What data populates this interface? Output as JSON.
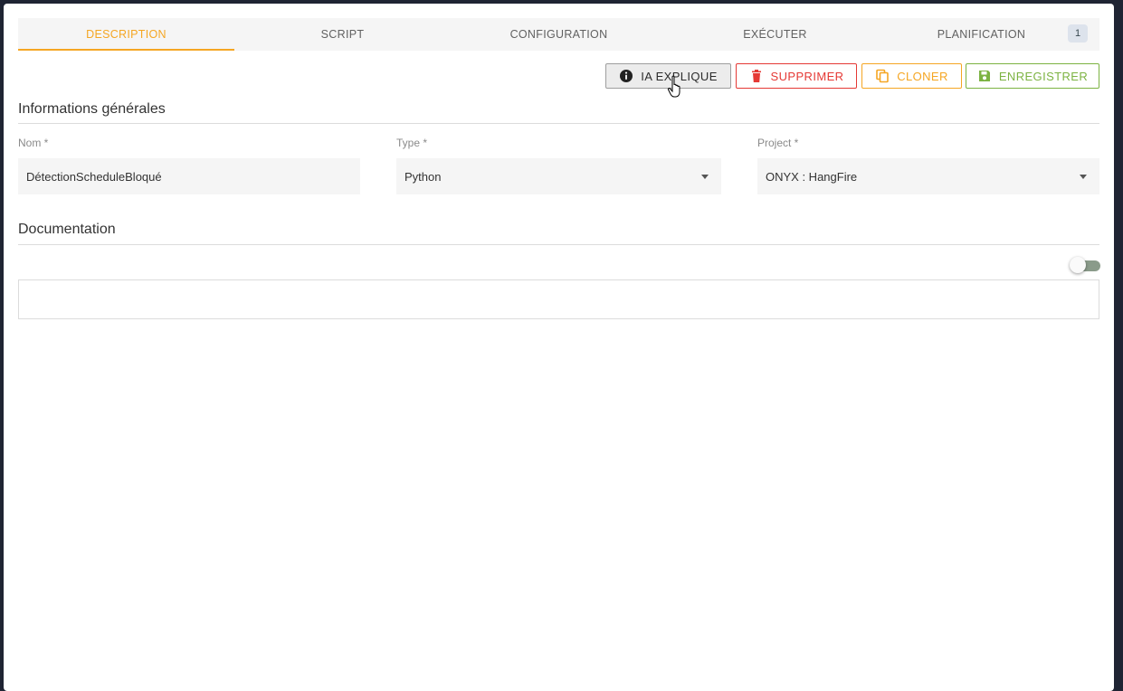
{
  "tabs": [
    {
      "label": "DESCRIPTION",
      "active": true
    },
    {
      "label": "SCRIPT",
      "active": false
    },
    {
      "label": "CONFIGURATION",
      "active": false
    },
    {
      "label": "EXÉCUTER",
      "active": false
    },
    {
      "label": "PLANIFICATION",
      "active": false
    }
  ],
  "planification_badge": "1",
  "actions": {
    "explain": {
      "label": "IA EXPLIQUE",
      "icon": "info-icon"
    },
    "delete": {
      "label": "SUPPRIMER",
      "icon": "trash-icon"
    },
    "clone": {
      "label": "CLONER",
      "icon": "copy-icon"
    },
    "save": {
      "label": "ENREGISTRER",
      "icon": "floppy-disk-icon"
    }
  },
  "general": {
    "title": "Informations générales",
    "name": {
      "label": "Nom *",
      "value": "DétectionScheduleBloqué"
    },
    "type": {
      "label": "Type *",
      "value": "Python"
    },
    "project": {
      "label": "Project *",
      "value": "ONYX : HangFire"
    }
  },
  "documentation": {
    "title": "Documentation",
    "content": ""
  },
  "colors": {
    "accent": "#f5a623",
    "danger": "#e53935",
    "success": "#7cb342"
  }
}
